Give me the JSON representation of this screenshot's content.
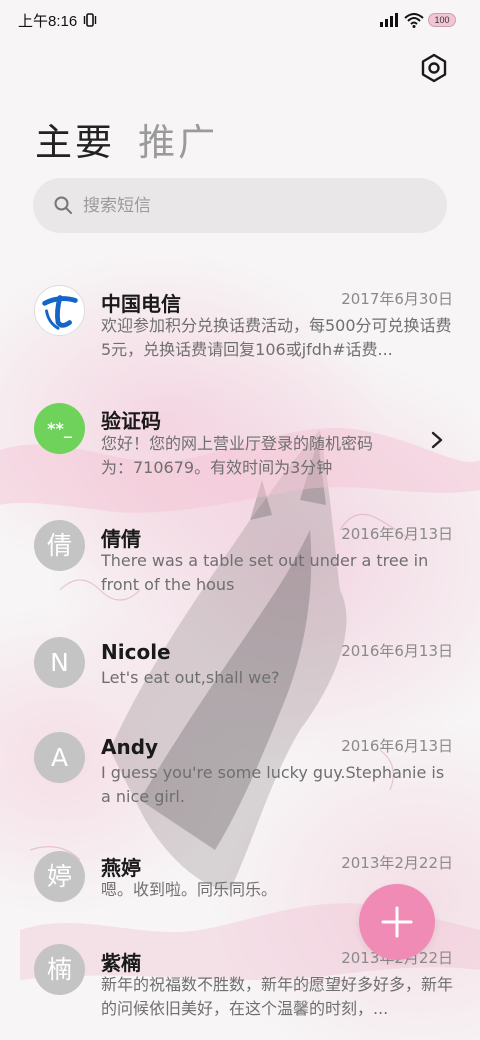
{
  "status_bar": {
    "time": "上午8:16",
    "battery": "100"
  },
  "tabs": [
    {
      "label": "主要"
    },
    {
      "label": "推广"
    }
  ],
  "search": {
    "placeholder": "搜索短信"
  },
  "conversations": [
    {
      "name": "中国电信",
      "date": "2017年6月30日",
      "preview": "欢迎参加积分兑换话费活动，每500分可兑换话费5元，兑换话费请回复106或jfdh#话费...",
      "avatar": "telecom-logo"
    },
    {
      "name": "验证码",
      "date": "",
      "preview": "您好！您的网上营业厅登录的随机密码为：710679。有效时间为3分钟",
      "avatar_text": "**_"
    },
    {
      "name": "倩倩",
      "date": "2016年6月13日",
      "preview": "There was a table set out under a tree in front of the hous",
      "avatar_text": "倩"
    },
    {
      "name": "Nicole",
      "date": "2016年6月13日",
      "preview": "Let's eat out,shall we?",
      "avatar_text": "N"
    },
    {
      "name": "Andy",
      "date": "2016年6月13日",
      "preview": "I guess you're some lucky guy.Stephanie is a nice girl.",
      "avatar_text": "A"
    },
    {
      "name": "燕婷",
      "date": "2013年2月22日",
      "preview": "嗯。收到啦。同乐同乐。",
      "avatar_text": "婷"
    },
    {
      "name": "紫楠",
      "date": "2013年2月22日",
      "preview": "新年的祝福数不胜数，新年的愿望好多好多，新年的问候依旧美好，在这个温馨的时刻，...",
      "avatar_text": "楠"
    }
  ],
  "colors": {
    "accent": "#ef8bb4",
    "verify_green": "#6fd35b",
    "telecom_blue": "#1565c8",
    "avatar_gray": "#c4c4c4"
  },
  "icons": {
    "settings": "hexagon-gear-icon",
    "search": "search-icon",
    "new_message": "plus-icon",
    "chevron": "chevron-right-icon"
  }
}
